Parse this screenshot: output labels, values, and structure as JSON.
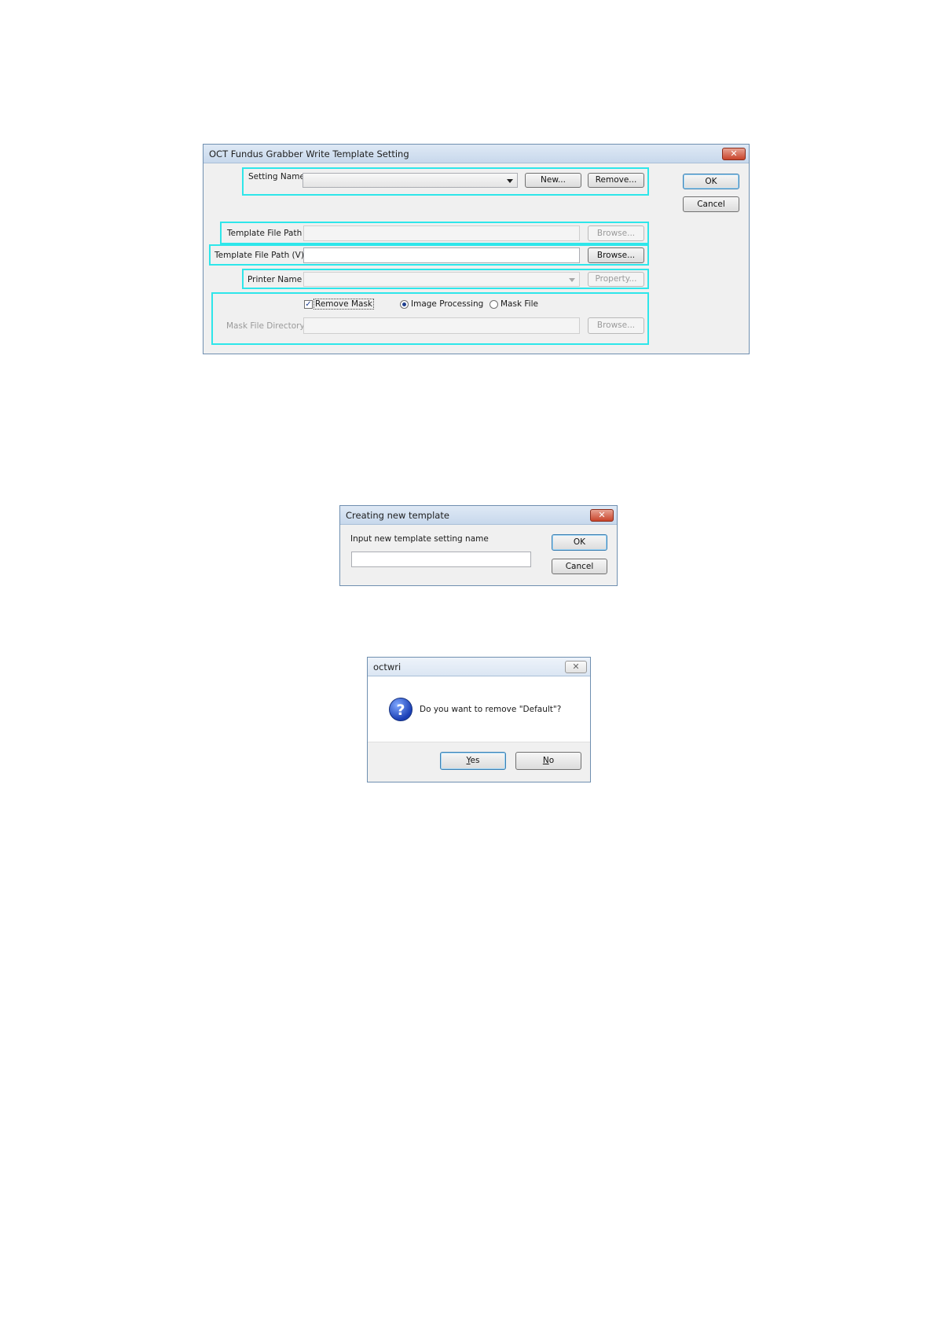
{
  "dialog1": {
    "title": "OCT Fundus Grabber Write Template Setting",
    "close_glyph": "✕",
    "setting_name_label": "Setting Name",
    "setting_name_value": "",
    "new_button": "New...",
    "remove_button": "Remove...",
    "ok_button": "OK",
    "cancel_button": "Cancel",
    "template_file_path_label": "Template File Path",
    "template_file_path_value": "",
    "browse_button_1": "Browse...",
    "template_file_path_v_label": "Template File Path (V)",
    "template_file_path_v_value": "",
    "browse_button_2": "Browse...",
    "printer_name_label": "Printer Name",
    "printer_name_value": "",
    "property_button": "Property...",
    "remove_mask_label": "Remove Mask",
    "remove_mask_checked": true,
    "radio_image_processing": "Image Processing",
    "radio_mask_file": "Mask File",
    "radio_selected": "Image Processing",
    "mask_file_directory_label": "Mask File Directory",
    "mask_file_directory_value": "",
    "browse_button_3": "Browse...",
    "highlight_color": "#2ee6ea"
  },
  "dialog2": {
    "title": "Creating new template",
    "close_glyph": "✕",
    "prompt": "Input new template setting name",
    "input_value": "",
    "ok_button": "OK",
    "cancel_button": "Cancel"
  },
  "dialog3": {
    "title": "octwri",
    "close_glyph": "✕",
    "icon": "question-icon",
    "icon_glyph": "?",
    "message": "Do you want to remove \"Default\"?",
    "yes_button_rest": "es",
    "yes_mnemonic": "Y",
    "no_button_rest": "o",
    "no_mnemonic": "N"
  }
}
